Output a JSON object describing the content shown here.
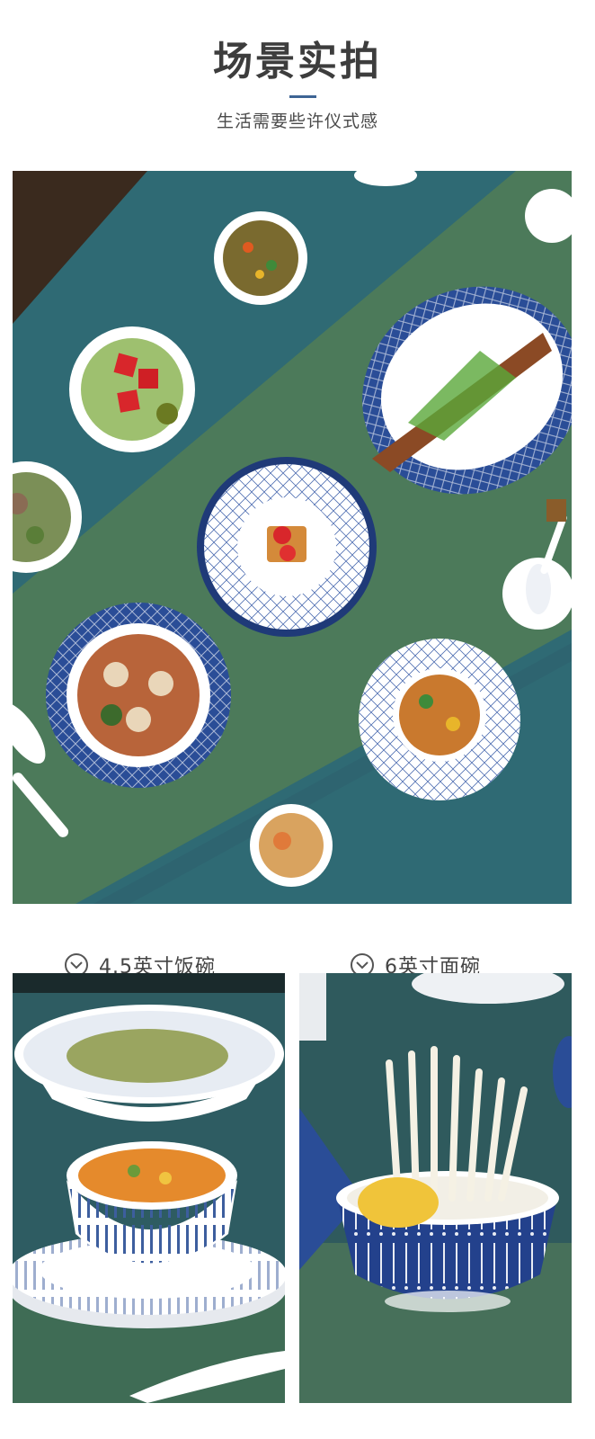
{
  "header": {
    "title": "场景实拍",
    "subtitle": "生活需要些许仪式感"
  },
  "colors": {
    "accent": "#3e6494",
    "tablecloth_teal": "#2f6a74",
    "runner_green": "#4c7a5a",
    "plate_blue": "#2a4d97"
  },
  "features": [
    {
      "icon": "chevron-down-circle-icon",
      "label": "4.5英寸饭碗"
    },
    {
      "icon": "chevron-down-circle-icon",
      "label": "6英寸面碗"
    }
  ]
}
